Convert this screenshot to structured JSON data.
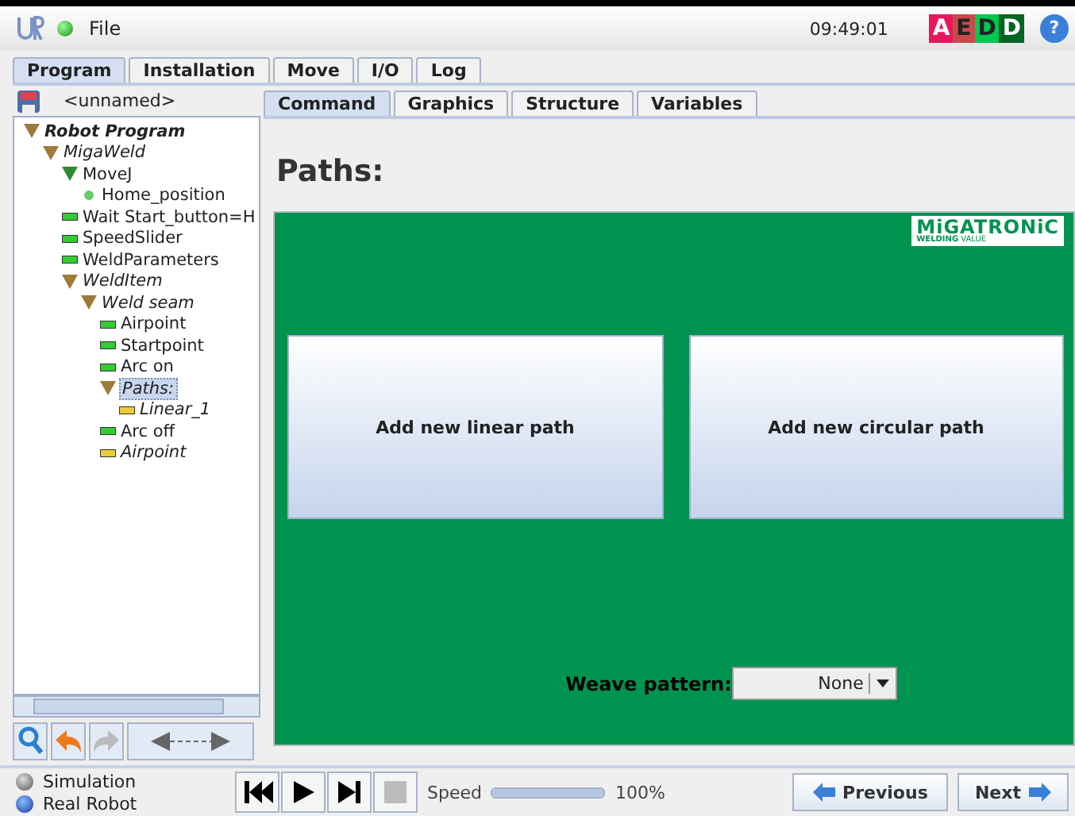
{
  "top_bar": {
    "menu": "File",
    "time": "09:49:01",
    "status_letters": [
      {
        "text": "A",
        "color": "#e8175d"
      },
      {
        "text": "E",
        "color": "#c94a4a"
      },
      {
        "text": "D",
        "color": "#00c853"
      },
      {
        "text": "D",
        "color": "#006622"
      }
    ],
    "help": "?"
  },
  "main_tabs": [
    {
      "label": "Program",
      "selected": true
    },
    {
      "label": "Installation",
      "selected": false
    },
    {
      "label": "Move",
      "selected": false
    },
    {
      "label": "I/O",
      "selected": false
    },
    {
      "label": "Log",
      "selected": false
    }
  ],
  "program_name": "<unnamed>",
  "tree": [
    {
      "label": "Robot Program",
      "kind": "root",
      "italic": true,
      "selected": false,
      "children": [
        {
          "label": "MigaWeld",
          "kind": "folder",
          "italic": true,
          "selected": false,
          "children": [
            {
              "label": "MoveJ",
              "kind": "move",
              "italic": false,
              "selected": false,
              "children": [
                {
                  "label": "Home_position",
                  "kind": "waypoint",
                  "italic": false,
                  "selected": false
                }
              ]
            },
            {
              "label": "Wait Start_button=H",
              "kind": "command",
              "italic": false,
              "selected": false
            },
            {
              "label": "SpeedSlider",
              "kind": "command",
              "italic": false,
              "selected": false
            },
            {
              "label": "WeldParameters",
              "kind": "command",
              "italic": false,
              "selected": false
            },
            {
              "label": "WeldItem",
              "kind": "folder",
              "italic": true,
              "selected": false,
              "children": [
                {
                  "label": "Weld seam",
                  "kind": "folder",
                  "italic": true,
                  "selected": false,
                  "children": [
                    {
                      "label": "Airpoint",
                      "kind": "command",
                      "italic": false,
                      "selected": false
                    },
                    {
                      "label": "Startpoint",
                      "kind": "command",
                      "italic": false,
                      "selected": false
                    },
                    {
                      "label": "Arc on",
                      "kind": "command",
                      "italic": false,
                      "selected": false
                    },
                    {
                      "label": "Paths:",
                      "kind": "folder",
                      "italic": true,
                      "selected": true,
                      "children": [
                        {
                          "label": "Linear_1",
                          "kind": "pending",
                          "italic": true,
                          "selected": false
                        }
                      ]
                    },
                    {
                      "label": "Arc off",
                      "kind": "command",
                      "italic": false,
                      "selected": false
                    },
                    {
                      "label": "Airpoint",
                      "kind": "pending",
                      "italic": true,
                      "selected": false
                    }
                  ]
                }
              ]
            }
          ]
        }
      ]
    }
  ],
  "sub_tabs": [
    {
      "label": "Command",
      "selected": true
    },
    {
      "label": "Graphics",
      "selected": false
    },
    {
      "label": "Structure",
      "selected": false
    },
    {
      "label": "Variables",
      "selected": false
    }
  ],
  "page_title": "Paths:",
  "logo": {
    "name": "MiGATRONiC",
    "tagline": "**WELDING** VALUE"
  },
  "path_buttons": [
    "Add new linear path",
    "Add new circular path"
  ],
  "weave": {
    "label": "Weave pattern:",
    "value": "None"
  },
  "bottom_bar": {
    "modes": [
      {
        "label": "Simulation",
        "selected": false
      },
      {
        "label": "Real Robot",
        "selected": true
      }
    ],
    "speed_label": "Speed",
    "speed": {
      "level": 1.0
    },
    "speed_reading": "100%",
    "previous": "Previous",
    "next": "Next"
  }
}
